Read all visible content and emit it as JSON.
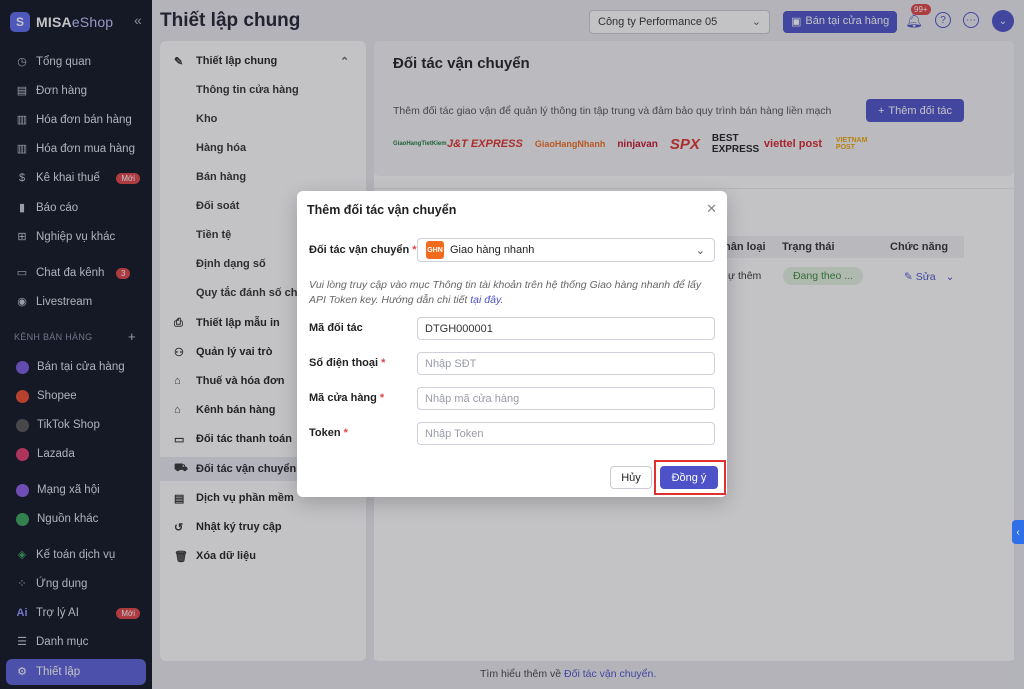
{
  "brand": {
    "name": "MISA",
    "suffix": "eShop",
    "collapse": "«"
  },
  "sidebar": {
    "items": [
      {
        "label": "Tổng quan",
        "icon": "dashboard-icon"
      },
      {
        "label": "Đơn hàng",
        "icon": "order-icon"
      },
      {
        "label": "Hóa đơn bán hàng",
        "icon": "invoice-icon"
      },
      {
        "label": "Hóa đơn mua hàng",
        "icon": "purchase-invoice-icon"
      },
      {
        "label": "Kê khai thuế",
        "icon": "tax-icon",
        "badge": "Mới"
      },
      {
        "label": "Báo cáo",
        "icon": "report-icon"
      },
      {
        "label": "Nghiệp vụ khác",
        "icon": "other-icon"
      },
      {
        "label": "Chat đa kênh",
        "icon": "chat-icon",
        "badge": "3"
      },
      {
        "label": "Livestream",
        "icon": "livestream-icon"
      }
    ],
    "section_label": "KÊNH BÁN HÀNG",
    "section_plus": "+",
    "channels": [
      {
        "label": "Bán tại cửa hàng",
        "color": "#7b5be0"
      },
      {
        "label": "Shopee",
        "color": "#ee4d2d"
      },
      {
        "label": "TikTok Shop",
        "color": "#222222"
      },
      {
        "label": "Lazada",
        "color": "#e23a6c"
      },
      {
        "label": "Mạng xã hội",
        "color": "#8a5ce6"
      },
      {
        "label": "Nguồn khác",
        "color": "#3aa35b"
      }
    ],
    "bottom": [
      {
        "label": "Kế toán dịch vụ",
        "icon": "accounting-icon"
      },
      {
        "label": "Ứng dụng",
        "icon": "apps-icon"
      },
      {
        "label": "Trợ lý AI",
        "icon": "ai-icon",
        "badge": "Mới"
      },
      {
        "label": "Danh mục",
        "icon": "catalog-icon"
      },
      {
        "label": "Thiết lập",
        "icon": "settings-icon"
      }
    ]
  },
  "header": {
    "title": "Thiết lập chung",
    "company": "Công ty Performance 05",
    "store_button": "Bán tại cửa hàng",
    "bell_badge": "99+"
  },
  "subnav": {
    "group": "Thiết lập chung",
    "children": [
      "Thông tin cửa hàng",
      "Kho",
      "Hàng hóa",
      "Bán hàng",
      "Đối soát",
      "Tiền tệ",
      "Định dạng số",
      "Quy tắc đánh số chứ"
    ],
    "items": [
      "Thiết lập mẫu in",
      "Quản lý vai trò",
      "Thuế và hóa đơn",
      "Kênh bán hàng",
      "Đối tác thanh toán",
      "Đối tác vận chuyển",
      "Dịch vụ phần mềm",
      "Nhật ký truy cập",
      "Xóa dữ liệu"
    ]
  },
  "page": {
    "title": "Đối tác vận chuyển",
    "desc": "Thêm đối tác giao vận để quản lý thông tin tập trung và đảm bảo quy trình bán hàng liền mạch",
    "add_button": "Thêm đối tác",
    "partners": [
      "GiaoHangTietKiem",
      "J&T EXPRESS",
      "GiaoHangNhanh",
      "ninjavan",
      "SPX",
      "BEST EXPRESS",
      "viettel post",
      "VIETNAM POST"
    ],
    "table_headers": [
      "hân loại",
      "Trạng thái",
      "Chức năng"
    ],
    "row": {
      "type": "ự thêm",
      "status": "Đang theo ...",
      "action": "Sửa"
    },
    "bottom_note": "Tìm hiểu thêm về ",
    "bottom_link": "Đối tác vận chuyển."
  },
  "modal": {
    "title": "Thêm đối tác vận chuyển",
    "partner_label": "Đối tác vận chuyển",
    "partner_value": "Giao hàng nhanh",
    "hint": "Vui lòng truy cập vào mục Thông tin tài khoản trên hệ thống Giao hàng nhanh để lấy API Token key. Hướng dẫn chi tiết ",
    "hint_link": "tại đây",
    "hint_end": ".",
    "fields": [
      {
        "label": "Mã đối tác",
        "value": "DTGH000001",
        "placeholder": "",
        "required": false
      },
      {
        "label": "Số điện thoại",
        "value": "",
        "placeholder": "Nhập SĐT",
        "required": true
      },
      {
        "label": "Mã cửa hàng",
        "value": "",
        "placeholder": "Nhập mã cửa hàng",
        "required": true
      },
      {
        "label": "Token",
        "value": "",
        "placeholder": "Nhập Token",
        "required": true
      }
    ],
    "cancel": "Hủy",
    "ok": "Đồng ý"
  }
}
